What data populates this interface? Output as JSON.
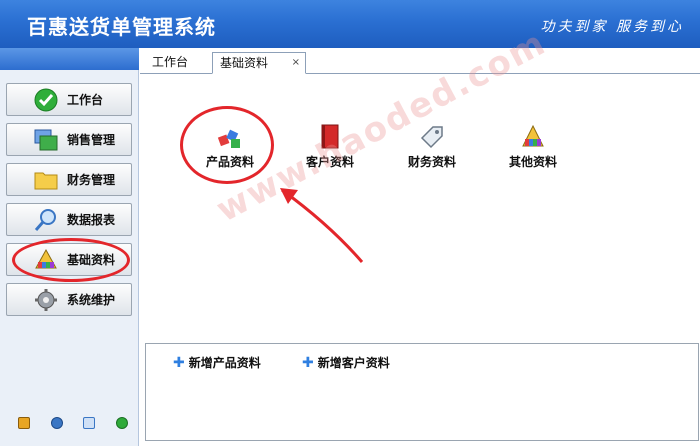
{
  "header": {
    "title": "百惠送货单管理系统",
    "slogan": "功夫到家 服务到心"
  },
  "sidebar": {
    "items": [
      {
        "label": "工作台",
        "icon": "check-icon"
      },
      {
        "label": "销售管理",
        "icon": "windows-icon"
      },
      {
        "label": "财务管理",
        "icon": "folder-icon"
      },
      {
        "label": "数据报表",
        "icon": "magnifier-icon"
      },
      {
        "label": "基础资料",
        "icon": "swatch-icon"
      },
      {
        "label": "系统维护",
        "icon": "gear-icon"
      }
    ],
    "tray_icons": [
      "key-icon",
      "clock-icon",
      "monitor-icon",
      "refresh-icon"
    ]
  },
  "tabs": [
    {
      "label": "工作台"
    },
    {
      "label": "基础资料",
      "close": "×"
    }
  ],
  "main": {
    "items": [
      {
        "label": "产品资料",
        "icon": "blocks-icon"
      },
      {
        "label": "客户资料",
        "icon": "red-book-icon"
      },
      {
        "label": "财务资料",
        "icon": "price-tag-icon"
      },
      {
        "label": "其他资料",
        "icon": "swatch-icon"
      }
    ],
    "quick_actions": [
      {
        "label": "新增产品资料",
        "icon": "plus-icon"
      },
      {
        "label": "新增客户资料",
        "icon": "plus-icon"
      }
    ]
  },
  "watermark": "www.haoded.com",
  "colors": {
    "header_blue": "#2a6fd2",
    "annotation_red": "#e3262b",
    "plus_blue": "#2f7fe0"
  }
}
